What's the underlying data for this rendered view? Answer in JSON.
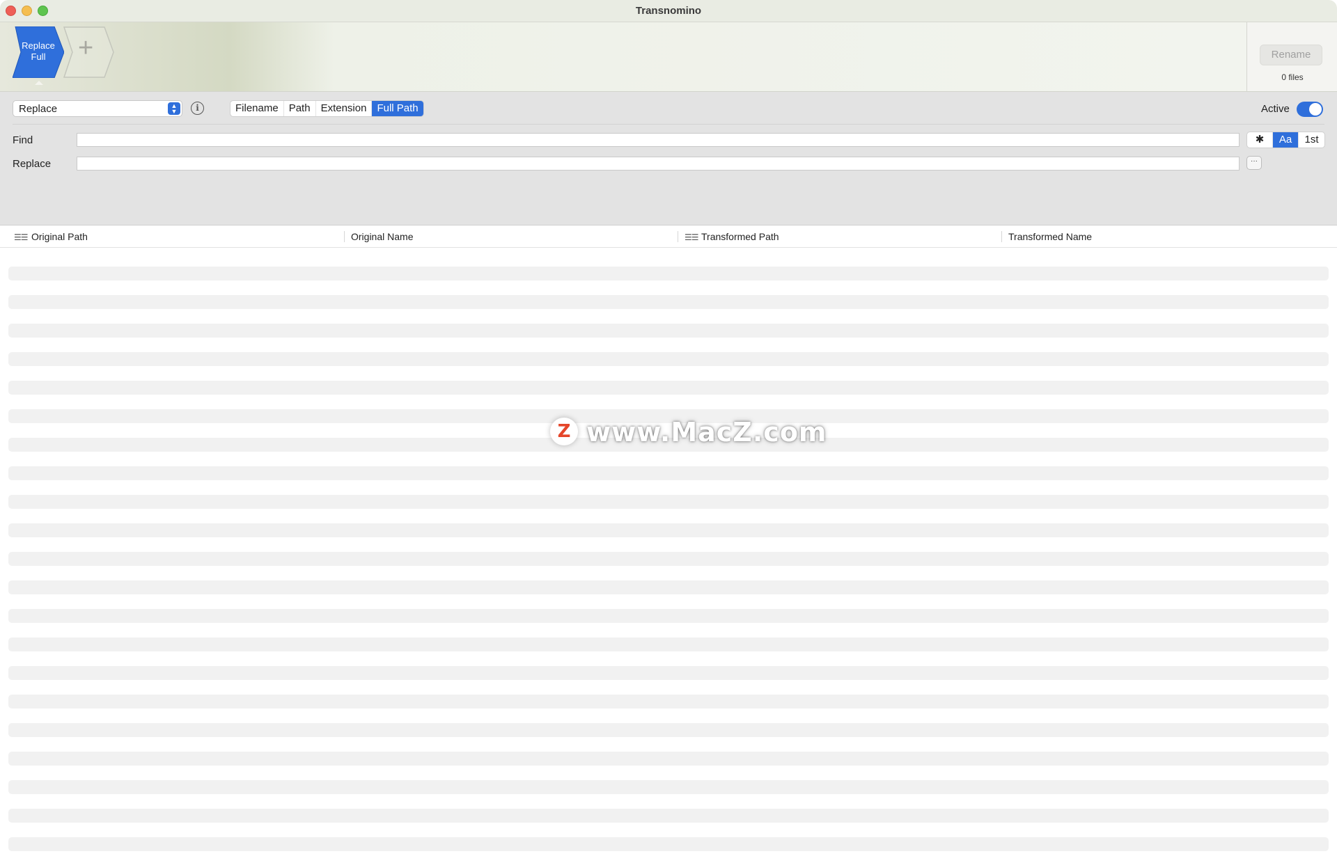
{
  "window": {
    "title": "Transnomino"
  },
  "rules": {
    "items": [
      {
        "label_line1": "Replace",
        "label_line2": "Full",
        "color": "#2f6fdb"
      }
    ],
    "add_symbol": "+"
  },
  "rename": {
    "button_label": "Rename",
    "file_count": "0 files"
  },
  "options": {
    "mode_value": "Replace",
    "info_symbol": "i",
    "scope_tabs": [
      {
        "label": "Filename",
        "selected": false
      },
      {
        "label": "Path",
        "selected": false
      },
      {
        "label": "Extension",
        "selected": false
      },
      {
        "label": "Full Path",
        "selected": true
      }
    ],
    "active_label": "Active",
    "active_on": true,
    "find_label": "Find",
    "find_value": "",
    "replace_label": "Replace",
    "replace_value": "",
    "find_options": [
      {
        "label": "✱",
        "on": false
      },
      {
        "label": "Aa",
        "on": true
      },
      {
        "label": "1st",
        "on": false
      }
    ],
    "more_symbol": "···"
  },
  "table": {
    "columns": [
      {
        "label": "Original Path",
        "has_icon": true
      },
      {
        "label": "Original Name",
        "has_icon": false
      },
      {
        "label": "Transformed Path",
        "has_icon": true
      },
      {
        "label": "Transformed Name",
        "has_icon": false
      }
    ],
    "rows": []
  },
  "watermark": {
    "logo": "Z",
    "text": "www.MacZ.com"
  },
  "colors": {
    "accent": "#2f6fdb",
    "toolbar_bg": "#e3e3e3"
  }
}
